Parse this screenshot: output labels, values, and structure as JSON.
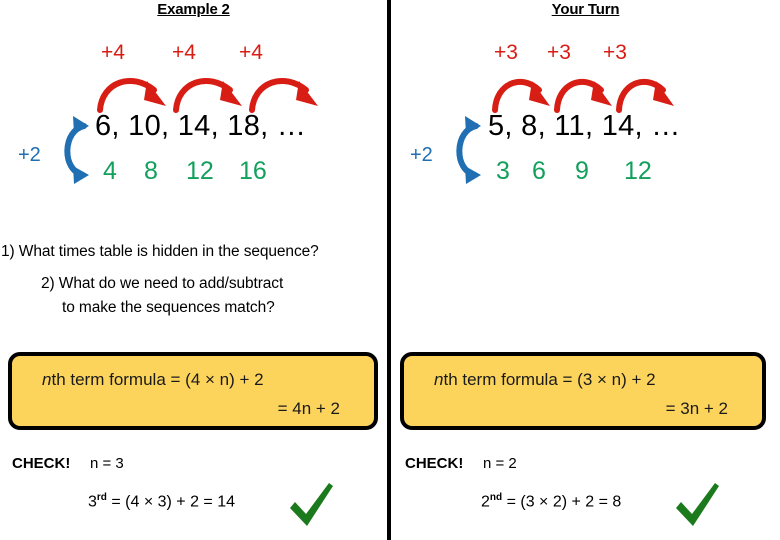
{
  "slide": {
    "background": "#ffffff",
    "divider_color": "#000000",
    "colors": {
      "step_red": "#D81D14",
      "multiple_green": "#12A05C",
      "hook_blue": "#1F6FB2",
      "box_fill": "#FCD45C",
      "box_border": "#000000",
      "tick_green": "#1B7A1B",
      "text_black": "#000000"
    }
  },
  "questions": {
    "q1": "1) What times table is hidden in the sequence?",
    "q2_line1": "2) What do we need to add/subtract",
    "q2_line2": "to make the sequences match?"
  },
  "panels": [
    {
      "id": "example-2",
      "title": "Example 2",
      "step_labels": [
        "+4",
        "+4",
        "+4"
      ],
      "step_label_x": [
        101,
        172,
        239
      ],
      "arc_count": 3,
      "sequence": "6, 10, 14, 18, …",
      "multiples": [
        "4",
        "8",
        "12",
        "16"
      ],
      "multiples_x": [
        6,
        47,
        89,
        142
      ],
      "plus_two_label": "+2",
      "formula": {
        "line1_prefix": "n",
        "line1_rest": "th term formula = (4 × n)  + 2",
        "line1_italic_var": "n",
        "line2": "= 4n + 2"
      },
      "check": {
        "label": "CHECK!",
        "n_value": "n = 3",
        "ordinal": "3",
        "ordinal_suffix": "rd",
        "calculation": " = (4 × 3) + 2 = 14",
        "tick": "green-tick"
      }
    },
    {
      "id": "your-turn",
      "title": "Your Turn",
      "step_labels": [
        "+3",
        "+3",
        "+3"
      ],
      "step_label_x": [
        103,
        156,
        212
      ],
      "arc_count": 3,
      "sequence": "5, 8, 11, 14, …",
      "multiples": [
        "3",
        "6",
        "9",
        "12"
      ],
      "multiples_x": [
        6,
        42,
        85,
        134
      ],
      "plus_two_label": "+2",
      "formula": {
        "line1_prefix": "n",
        "line1_rest": "th term formula = (3 × n)  + 2",
        "line1_italic_var": "n",
        "line2": "= 3n + 2"
      },
      "check": {
        "label": "CHECK!",
        "n_value": "n = 2",
        "ordinal": "2",
        "ordinal_suffix": "nd",
        "calculation": " = (3 × 2) + 2 = 8",
        "tick": "green-tick"
      }
    }
  ]
}
